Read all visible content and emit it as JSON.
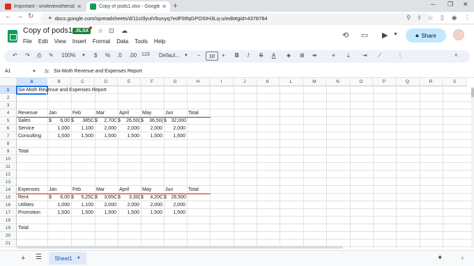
{
  "browser": {
    "tabs": [
      {
        "title": "Important - smilevenothersdont@...",
        "active": false,
        "favicon_color": "#d93025"
      },
      {
        "title": "Copy of pods1.xlsx - Google Sheets",
        "active": true,
        "favicon_color": "#0f9d58"
      }
    ],
    "new_tab": "+",
    "url": "docs.google.com/spreadsheets/d/11c0lyutVbunyq7edF9IfqGPOSIH3Lq-u/edit#gid=4378784"
  },
  "doc": {
    "title": "Copy of pods1",
    "badge": ".XLSX",
    "share_label": "Share"
  },
  "menu": [
    "File",
    "Edit",
    "View",
    "Insert",
    "Format",
    "Data",
    "Tools",
    "Help"
  ],
  "toolbar": {
    "zoom": "100%",
    "currency": "$",
    "percent": "%",
    "dec_less": ".0",
    "dec_more": ".00",
    "number_format": "123",
    "font": "Defaul...",
    "font_size": "10",
    "bold": "B",
    "italic": "I",
    "strike": "S",
    "text_color": "A",
    "minus": "−",
    "plus": "+"
  },
  "formula_bar": {
    "name_box": "A1",
    "fx": "fx",
    "value": "Six-Moth Revenue and Expenses Report"
  },
  "grid": {
    "columns": [
      "A",
      "B",
      "C",
      "D",
      "E",
      "F",
      "G",
      "H",
      "I",
      "J",
      "K",
      "L",
      "M",
      "N",
      "O",
      "P",
      "Q",
      "R",
      "S"
    ],
    "rows": [
      "1",
      "2",
      "3",
      "4",
      "5",
      "6",
      "7",
      "8",
      "9",
      "10",
      "11",
      "12",
      "13",
      "14",
      "15",
      "16",
      "17",
      "18",
      "19",
      "20",
      "21"
    ],
    "cells": {
      "title": "Six-Moth Revenue and Expenses Report",
      "revenue_header": [
        "Revenue",
        "Jan",
        "Feb",
        "Mar",
        "April",
        "May",
        "Jun",
        "Total"
      ],
      "sales": [
        "Sales",
        "$",
        "6,00",
        "$",
        "385C",
        "$",
        "2,70C",
        "$",
        "26,50(",
        "$",
        "36,50(",
        "$",
        "32,000"
      ],
      "service": [
        "Service",
        "1,000",
        "1,100",
        "2,000",
        "2,000",
        "2,000",
        "2,000"
      ],
      "consulting": [
        "Consulting",
        "1,500",
        "1,500",
        "1,500",
        "1,500",
        "1,500",
        "1,500"
      ],
      "rev_total": "Total",
      "expenses_header": [
        "Expenses",
        "Jan",
        "Feb",
        "Mar",
        "April",
        "May",
        "Jun",
        "Total"
      ],
      "rent": [
        "Rent",
        "$",
        "6,00",
        "$",
        "5,25C",
        "$",
        "3,65C",
        "$",
        "3,30(",
        "$",
        "4,20C",
        "$",
        "26,500"
      ],
      "utilities": [
        "Utilities",
        "1,000",
        "1,100",
        "2,000",
        "2,000",
        "2,000",
        "2,000"
      ],
      "promotion": [
        "Promotion",
        "1,500",
        "1,500",
        "1,500",
        "1,500",
        "1,500",
        "1,500"
      ],
      "exp_total": "Total"
    }
  },
  "sheets": {
    "add": "+",
    "active": "Sheet1"
  }
}
